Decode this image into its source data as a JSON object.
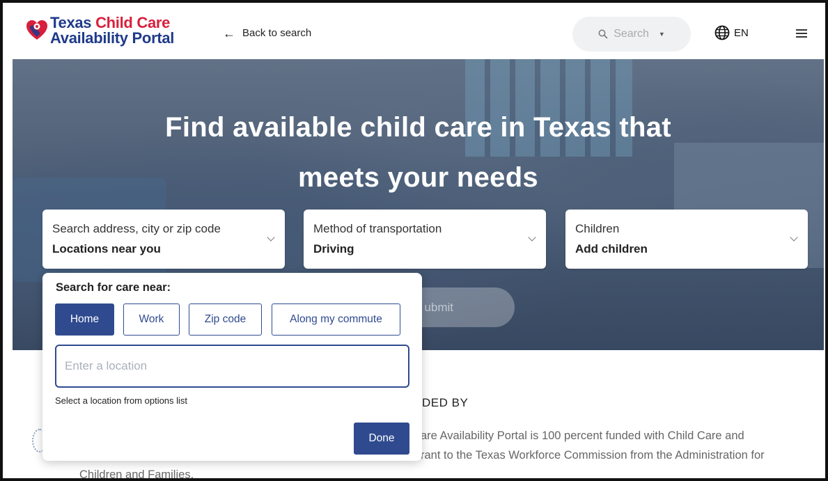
{
  "header": {
    "logo_line1_texas": "Texas",
    "logo_line1_childcare": "Child Care",
    "logo_line2": "Availability Portal",
    "back_label": "Back to search",
    "search_placeholder": "Search",
    "language": "EN"
  },
  "hero": {
    "title_line1": "Find available child care in Texas that",
    "title_line2": "meets your needs"
  },
  "selectors": {
    "location": {
      "label": "Search address, city or zip code",
      "value": "Locations near you"
    },
    "transport": {
      "label": "Method of transportation",
      "value": "Driving"
    },
    "children": {
      "label": "Children",
      "value": "Add children"
    }
  },
  "submit_label": "ubmit",
  "dropdown": {
    "heading": "Search for care near:",
    "options": [
      "Home",
      "Work",
      "Zip code",
      "Along my commute"
    ],
    "selected": "Home",
    "input_placeholder": "Enter a location",
    "helper": "Select a location from options list",
    "done_label": "Done"
  },
  "funded": {
    "title": "DED BY",
    "line1": "are Availability Portal is 100 percent funded with Child Care and",
    "line2": "rant to the Texas Workforce Commission from the Administration for",
    "line3": "Children and Families."
  },
  "colors": {
    "brand_blue": "#2f4a8f",
    "logo_red": "#d81f3c",
    "logo_navy": "#1f3a8a"
  }
}
